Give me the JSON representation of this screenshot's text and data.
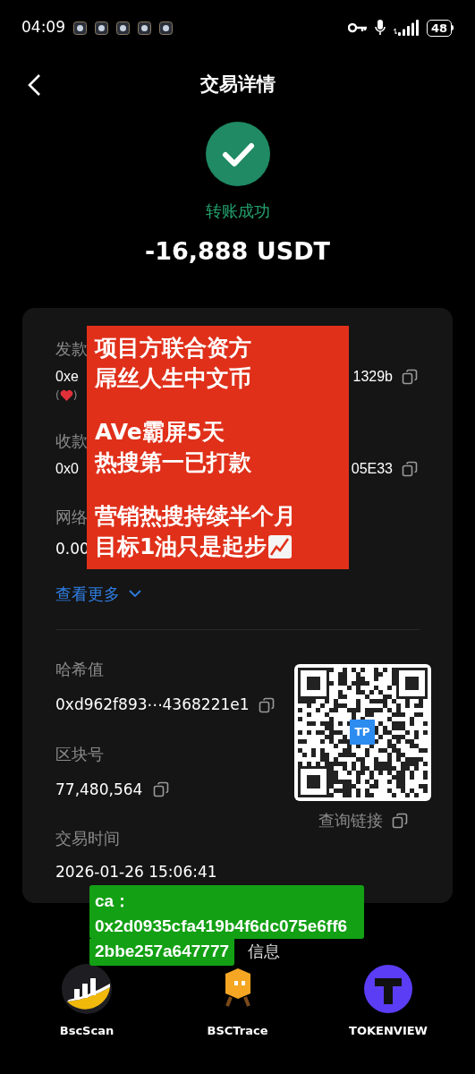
{
  "status_bar": {
    "time": "04:09",
    "battery": "48"
  },
  "header": {
    "title": "交易详情"
  },
  "result": {
    "status": "转账成功",
    "amount": "-16,888 USDT"
  },
  "details": {
    "sender": {
      "label": "发款",
      "address_start": "0xe",
      "address_end": "1329b",
      "note_brackets": [
        "(",
        ")"
      ]
    },
    "receiver": {
      "label": "收款",
      "address_start": "0x0",
      "address_end": "05E33"
    },
    "fee": {
      "label": "网络",
      "value": "0.00"
    },
    "more_link": "查看更多",
    "hash": {
      "label": "哈希值",
      "value": "0xd962f893⋯4368221e1"
    },
    "block": {
      "label": "区块号",
      "value": "77,480,564"
    },
    "time": {
      "label": "交易时间",
      "value": "2026-01-26 15:06:41"
    },
    "qr": {
      "badge": "TP",
      "link": "查询链接"
    }
  },
  "bottom_link": "信息",
  "explorers": [
    {
      "kind": "bscscan",
      "name": "BscScan"
    },
    {
      "kind": "bsctrace",
      "name": "BSCTrace"
    },
    {
      "kind": "tokenview",
      "name": "TOKENVIEW"
    }
  ],
  "red_note": {
    "groups": [
      [
        "项目方联合资方",
        "屌丝人生中文币"
      ],
      [
        "AVe霸屏5天",
        "热搜第一已打款"
      ],
      [
        "营销热搜持续半个月",
        "目标1油只是起步"
      ]
    ]
  },
  "green_note": {
    "lines": [
      "ca：",
      "0x2d0935cfa419b4f6dc075e6ff6",
      "2bbe257a647777"
    ]
  }
}
